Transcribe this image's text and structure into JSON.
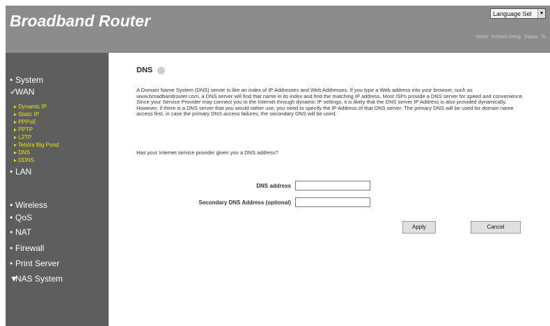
{
  "header": {
    "logo": "Broadband Router",
    "language_select": "Language Sel",
    "top_links": [
      "Home",
      "Restart Setup",
      "Status",
      "To"
    ]
  },
  "sidebar": {
    "items": [
      {
        "label": "System"
      },
      {
        "label": "WAN",
        "active": true
      },
      {
        "label": "LAN"
      },
      {
        "label": "Wireless"
      },
      {
        "label": "QoS"
      },
      {
        "label": "NAT"
      },
      {
        "label": "Firewall"
      },
      {
        "label": "Print Server"
      },
      {
        "label": "NAS System"
      }
    ],
    "wan_submenu": [
      "Dynamic IP",
      "Static IP",
      "PPPoE",
      "PPTP",
      "L2TP",
      "Telstra Big Pond",
      "DNS",
      "DDNS"
    ]
  },
  "main": {
    "title": "DNS",
    "description": "A Domain Name System (DNS) server is like an index of IP Addresses and Web Addresses. If you type a Web address into your browser, such as www.broadbandrouter.com, a DNS server will find that name in its index and find the matching IP address. Most ISPs provide a DNS server for speed and convenience. Since your Service Provider may connect you to the Internet through dynamic IP settings, it is likely that the DNS server IP Address is also provided dynamically. However, if there is a DNS server that you would rather use, you need to specify the IP Address of that DNS server. The primary DNS will be used for domain name access first, in case the primary DNS access failures, the secondary DNS will be used.",
    "question": "Has your Internet service provider given you a DNS address?",
    "dns_label": "DNS address",
    "dns_value": "",
    "secondary_label": "Secondary DNS Address (optional)",
    "secondary_value": "",
    "apply_label": "Apply",
    "cancel_label": "Cancel"
  }
}
